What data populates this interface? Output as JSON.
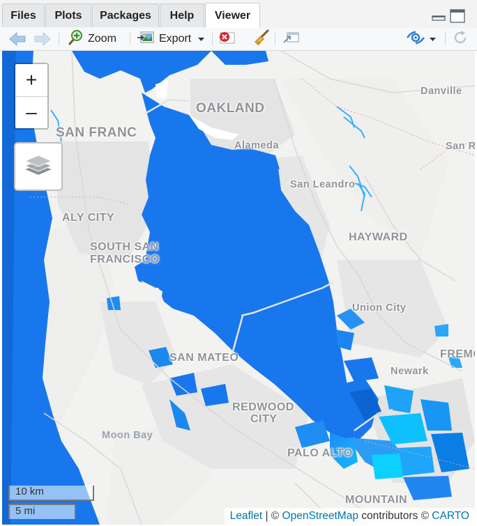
{
  "tabs": [
    {
      "label": "Files",
      "active": false
    },
    {
      "label": "Plots",
      "active": false
    },
    {
      "label": "Packages",
      "active": false
    },
    {
      "label": "Help",
      "active": false
    },
    {
      "label": "Viewer",
      "active": true
    }
  ],
  "toolbar": {
    "zoom_label": "Zoom",
    "export_label": "Export",
    "icons": [
      "back-arrow-icon",
      "forward-arrow-icon",
      "zoom-icon",
      "export-icon",
      "clear-icon",
      "broom-icon",
      "show-in-window-icon",
      "publish-icon",
      "refresh-icon"
    ]
  },
  "map": {
    "controls": {
      "zoom_in": "+",
      "zoom_out": "–"
    },
    "scale": {
      "metric": "10 km",
      "imperial": "5 mi"
    },
    "attribution": {
      "leaflet": "Leaflet",
      "sep1": " | © ",
      "osm": "OpenStreetMap",
      "contrib": " contributors © ",
      "carto": "CARTO"
    },
    "labels": {
      "oakland": "OAKLAND",
      "sanfran": "SAN FRANC",
      "danville": "Danville",
      "sanr": "San R",
      "alameda": "Alameda",
      "sanleandro": "San Leandro",
      "dalycity": "ALY CITY",
      "southsf1": "SOUTH SAN",
      "southsf2": "FRANCISCO",
      "hayward": "HAYWARD",
      "unioncity": "Union City",
      "fremont": "FREMONT",
      "sanmateo": "SAN MATEO",
      "newark": "Newark",
      "redwood1": "REDWOOD",
      "redwood2": "CITY",
      "moonbay": "Moon Bay",
      "paloalto": "PALO ALTO",
      "mountain": "MOUNTAIN"
    },
    "colors": {
      "water": "#1877ec",
      "shallow": "#00b4ff",
      "land": "#f2f2f0"
    }
  }
}
